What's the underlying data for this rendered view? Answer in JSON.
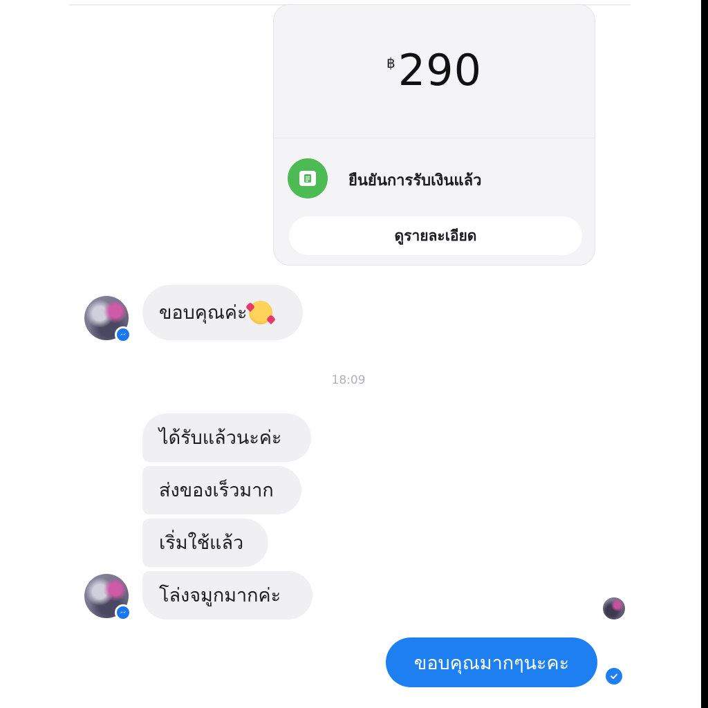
{
  "payment": {
    "currency": "฿",
    "amount": "290",
    "status_text": "ยืนยันการรับเงินแล้ว",
    "details_button": "ดูรายละเอียด"
  },
  "conversation": {
    "first_reply": "ขอบคุณค่ะ",
    "timestamp": "18:09",
    "incoming_messages": [
      "ได้รับแล้วนะค่ะ",
      "ส่งของเร็วมาก",
      "เริ่มใช้แล้ว",
      "โล่งจมูกมากค่ะ"
    ],
    "outgoing_message": "ขอบคุณมากๆนะคะ"
  },
  "colors": {
    "outgoing_bubble": "#1e7ff0",
    "incoming_bubble": "#f0f0f3",
    "payment_status_icon": "#4cbb53",
    "messenger_badge": "#1877f2"
  },
  "icons": {
    "payment_status": "bill-icon",
    "messenger_badge": "messenger-icon",
    "emoji": "smiling-face-with-hearts-emoji",
    "delivered": "check-circle-icon"
  }
}
